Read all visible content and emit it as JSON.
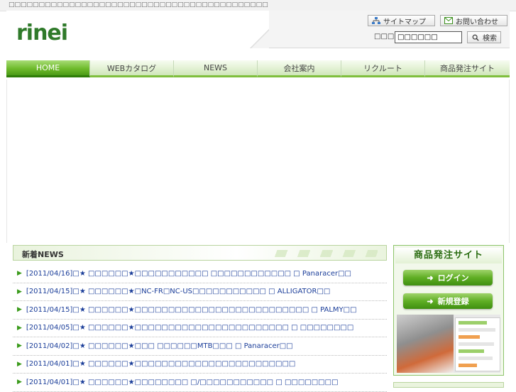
{
  "topbar": {
    "text": "□□□□□□□□□□□□□□□□□□□□□□□□□□□□□□□□□□□□□□□□□□□"
  },
  "logo": "rinei",
  "header": {
    "sitemap_label": "サイトマップ",
    "contact_label": "お問い合わせ",
    "search_label": "□□□□",
    "search_value": "□□□□□□",
    "search_button": "検索"
  },
  "nav": {
    "items": [
      {
        "label": "HOME",
        "active": true
      },
      {
        "label": "WEBカタログ"
      },
      {
        "label": "NEWS"
      },
      {
        "label": "会社案内"
      },
      {
        "label": "リクルート"
      },
      {
        "label": "商品発注サイト"
      }
    ]
  },
  "news": {
    "title": "新着NEWS",
    "items": [
      {
        "date": "[2011/04/16]",
        "text": "□★ □□□□□□★□□□□□□□□□□□ □□□□□□□□□□□□ □ Panaracer□□"
      },
      {
        "date": "[2011/04/15]",
        "text": "□★ □□□□□□★□NC-FR□NC-US□□□□□□□□□□□ □ ALLIGATOR□□"
      },
      {
        "date": "[2011/04/15]",
        "text": "□★ □□□□□□★□□□□□□□□□□□□□□□□□□□□□□□□□□ □ PALMY□□"
      },
      {
        "date": "[2011/04/05]",
        "text": "□★ □□□□□□★□□□□□□□□□□□□□□□□□□□□□□□ □ □□□□□□□□"
      },
      {
        "date": "[2011/04/02]",
        "text": "□★ □□□□□□★□□□ □□□□□□MTB□□□ □ Panaracer□□"
      },
      {
        "date": "[2011/04/01]",
        "text": "□★ □□□□□□★□□□□□□□□□□□□□□□□□□□□□□□□"
      },
      {
        "date": "[2011/04/01]",
        "text": "□★ □□□□□□★□□□□□□□□ □/□□□□□□□□□□□ □ □□□□□□□□"
      }
    ]
  },
  "side": {
    "title": "商品発注サイト",
    "login_label": "ログイン",
    "register_label": "新規登録"
  },
  "colors": {
    "brand_green": "#2f7a2a",
    "nav_active": "#6fbb2c",
    "link_blue": "#1a3d99"
  }
}
